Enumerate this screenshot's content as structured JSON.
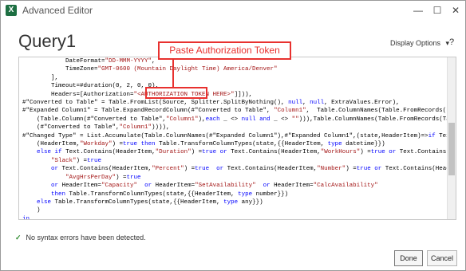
{
  "window": {
    "title": "Advanced Editor",
    "app_icon_letter": "X",
    "controls": {
      "minimize": "—",
      "maximize": "☐",
      "close": "✕"
    }
  },
  "header": {
    "query_name": "Query1",
    "display_options_label": "Display Options",
    "display_options_caret": "▾",
    "help_glyph": "?"
  },
  "annotation": {
    "callout_text": "Paste Authorization Token",
    "color": "#e8312f"
  },
  "code_lines": [
    "            DateFormat=\"DD-MMM-YYYY\",",
    "            TimeZone=\"GMT-0600 (Mountain Daylight Time) America/Denver\"",
    "        ],",
    "        Timeout=#duration(0, 2, 0, 0),",
    "        Headers=[Authorization=\"<AUTHORIZATION TOKEN HERE>\"]])),",
    "#\"Converted to Table\" = Table.FromList(Source, Splitter.SplitByNothing(), null, null, ExtraValues.Error),",
    "#\"Expanded Column1\" = Table.ExpandRecordColumn(#\"Converted to Table\", \"Column1\",  Table.ColumnNames(Table.FromRecords(List.Select",
    "    (Table.Column(#\"Converted to Table\",\"Column1\"),each _ <> null and _ <> \"\"))),Table.ColumnNames(Table.FromRecords(Table.Column",
    "    (#\"Converted to Table\",\"Column1\")))),",
    "#\"Changed Type\" = List.Accumulate(Table.ColumnNames(#\"Expanded Column1\"),#\"Expanded Column1\",(state,HeaderItem)=>if Text.Contains",
    "    (HeaderItem,\"Workday\") =true then Table.TransformColumnTypes(state,{{HeaderItem, type datetime}})",
    "    else if Text.Contains(HeaderItem,\"Duration\") =true or Text.Contains(HeaderItem,\"WorkHours\") =true or Text.Contains(HeaderItem,",
    "        \"Slack\") =true",
    "        or Text.Contains(HeaderItem,\"Percent\") =true  or Text.Contains(HeaderItem,\"Number\") =true or Text.Contains(HeaderItem,",
    "            \"AvgHrsPerDay\") =true",
    "        or HeaderItem=\"Capacity\"  or HeaderItem=\"SetAvailability\"  or HeaderItem=\"CalcAvailability\"",
    "        then Table.TransformColumnTypes(state,{{HeaderItem, type number}})",
    "    else Table.TransformColumnTypes(state,{{HeaderItem, type any}})",
    "    )",
    "in",
    "    #\"Changed Type\""
  ],
  "status": {
    "check_glyph": "✓",
    "message": "No syntax errors have been detected."
  },
  "buttons": {
    "done": "Done",
    "cancel": "Cancel"
  }
}
